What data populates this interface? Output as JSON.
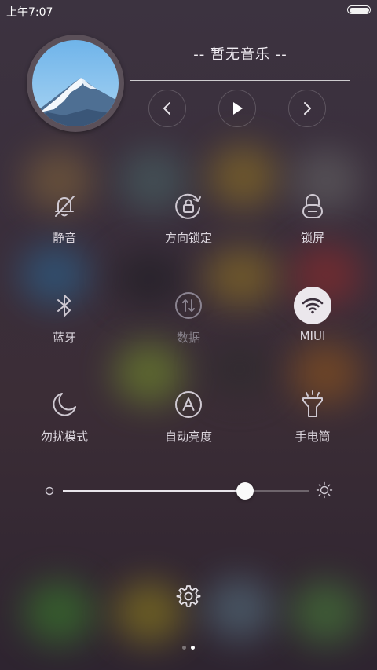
{
  "status_bar": {
    "time": "上午7:07",
    "battery_level": 1.0
  },
  "music": {
    "title": "-- 暂无音乐 --",
    "album_icon": "mountain-album-art",
    "prev_icon": "chevron-left-icon",
    "play_icon": "play-icon",
    "next_icon": "chevron-right-icon"
  },
  "toggles": [
    {
      "label": "静音",
      "icon": "bell-off-icon",
      "active": false,
      "disabled": false
    },
    {
      "label": "方向锁定",
      "icon": "rotation-lock-icon",
      "active": false,
      "disabled": false
    },
    {
      "label": "锁屏",
      "icon": "lock-icon",
      "active": false,
      "disabled": false
    },
    {
      "label": "蓝牙",
      "icon": "bluetooth-icon",
      "active": false,
      "disabled": false
    },
    {
      "label": "数据",
      "icon": "mobile-data-icon",
      "active": false,
      "disabled": true
    },
    {
      "label": "MIUI",
      "icon": "wifi-icon",
      "active": true,
      "disabled": false
    },
    {
      "label": "勿扰模式",
      "icon": "moon-icon",
      "active": false,
      "disabled": false
    },
    {
      "label": "自动亮度",
      "icon": "auto-brightness-icon",
      "active": false,
      "disabled": false
    },
    {
      "label": "手电筒",
      "icon": "flashlight-icon",
      "active": false,
      "disabled": false
    }
  ],
  "brightness": {
    "level": 0.74,
    "low_icon": "brightness-low-icon",
    "high_icon": "sun-icon"
  },
  "settings_icon": "gear-icon",
  "pager": {
    "page_count": 2,
    "current_page": 2
  },
  "colors": {
    "accent_on": "#ebe7ec",
    "text": "#dcd6de",
    "text_disabled": "#86808a"
  }
}
